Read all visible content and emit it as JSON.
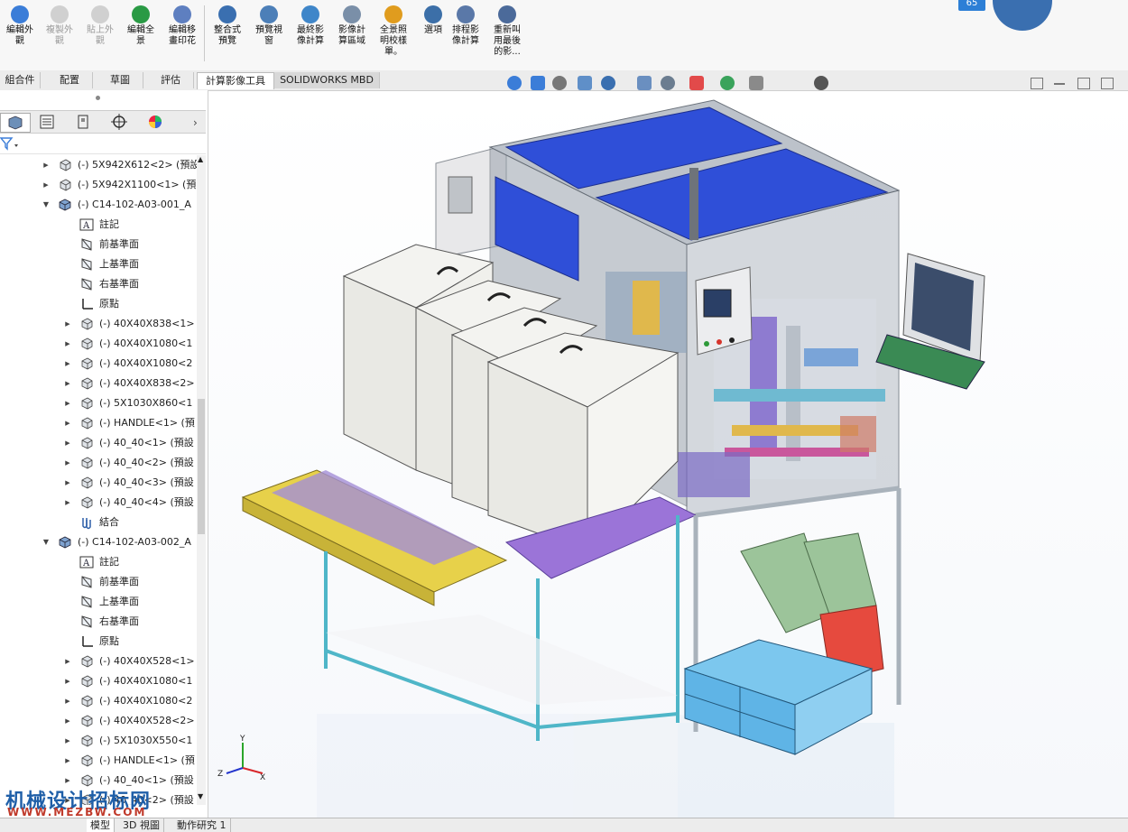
{
  "ribbon": {
    "buttons": [
      {
        "label": "編輯外\n觀",
        "icon": "edit-appearance-icon",
        "enabled": true
      },
      {
        "label": "複製外\n觀",
        "icon": "copy-appearance-icon",
        "enabled": false
      },
      {
        "label": "貼上外\n觀",
        "icon": "paste-appearance-icon",
        "enabled": false
      },
      {
        "label": "編輯全\n景",
        "icon": "edit-scene-icon",
        "enabled": true
      },
      {
        "label": "編輯移\n畫印花",
        "icon": "edit-decal-icon",
        "enabled": true
      },
      {
        "label": "整合式\n預覽",
        "icon": "integrated-preview-icon",
        "enabled": true
      },
      {
        "label": "預覽視\n窗",
        "icon": "preview-window-icon",
        "enabled": true
      },
      {
        "label": "最終影\n像計算",
        "icon": "final-render-icon",
        "enabled": true
      },
      {
        "label": "影像計\n算區域",
        "icon": "render-region-icon",
        "enabled": true
      },
      {
        "label": "全景照\n明校樣\n單。",
        "icon": "illumination-proof-icon",
        "enabled": true
      },
      {
        "label": "選項",
        "icon": "options-icon",
        "enabled": true
      },
      {
        "label": "排程影\n像計算",
        "icon": "schedule-render-icon",
        "enabled": true
      },
      {
        "label": "重新叫\n用最後\n的影...",
        "icon": "recall-last-render-icon",
        "enabled": true
      }
    ],
    "badge": "65"
  },
  "tabs": [
    {
      "label": "組合件",
      "active": false
    },
    {
      "label": "配置",
      "active": false
    },
    {
      "label": "草圖",
      "active": false
    },
    {
      "label": "評估",
      "active": false
    },
    {
      "label": "計算影像工具",
      "active": true
    },
    {
      "label": "SOLIDWORKS MBD",
      "active": false
    }
  ],
  "tree": [
    {
      "label": "(-) 5X942X612<2> (預設",
      "indent": 1,
      "arrow": "right",
      "icon": "part-icon"
    },
    {
      "label": "(-) 5X942X1100<1> (預",
      "indent": 1,
      "arrow": "right",
      "icon": "part-icon"
    },
    {
      "label": "(-) C14-102-A03-001_A",
      "indent": 1,
      "arrow": "down",
      "icon": "assembly-icon"
    },
    {
      "label": "註記",
      "indent": 2,
      "arrow": "",
      "icon": "annotation-icon"
    },
    {
      "label": "前基準面",
      "indent": 2,
      "arrow": "",
      "icon": "plane-icon"
    },
    {
      "label": "上基準面",
      "indent": 2,
      "arrow": "",
      "icon": "plane-icon"
    },
    {
      "label": "右基準面",
      "indent": 2,
      "arrow": "",
      "icon": "plane-icon"
    },
    {
      "label": "原點",
      "indent": 2,
      "arrow": "",
      "icon": "origin-icon"
    },
    {
      "label": "(-) 40X40X838<1>",
      "indent": 2,
      "arrow": "right",
      "icon": "part-icon"
    },
    {
      "label": "(-) 40X40X1080<1",
      "indent": 2,
      "arrow": "right",
      "icon": "part-icon"
    },
    {
      "label": "(-) 40X40X1080<2",
      "indent": 2,
      "arrow": "right",
      "icon": "part-icon"
    },
    {
      "label": "(-) 40X40X838<2>",
      "indent": 2,
      "arrow": "right",
      "icon": "part-icon"
    },
    {
      "label": "(-) 5X1030X860<1",
      "indent": 2,
      "arrow": "right",
      "icon": "part-icon"
    },
    {
      "label": "(-) HANDLE<1> (預",
      "indent": 2,
      "arrow": "right",
      "icon": "part-icon"
    },
    {
      "label": "(-) 40_40<1> (預設",
      "indent": 2,
      "arrow": "right",
      "icon": "part-icon"
    },
    {
      "label": "(-) 40_40<2> (預設",
      "indent": 2,
      "arrow": "right",
      "icon": "part-icon"
    },
    {
      "label": "(-) 40_40<3> (預設",
      "indent": 2,
      "arrow": "right",
      "icon": "part-icon"
    },
    {
      "label": "(-) 40_40<4> (預設",
      "indent": 2,
      "arrow": "right",
      "icon": "part-icon"
    },
    {
      "label": "結合",
      "indent": 2,
      "arrow": "",
      "icon": "mates-icon"
    },
    {
      "label": "(-) C14-102-A03-002_A",
      "indent": 1,
      "arrow": "down",
      "icon": "assembly-icon"
    },
    {
      "label": "註記",
      "indent": 2,
      "arrow": "",
      "icon": "annotation-icon"
    },
    {
      "label": "前基準面",
      "indent": 2,
      "arrow": "",
      "icon": "plane-icon"
    },
    {
      "label": "上基準面",
      "indent": 2,
      "arrow": "",
      "icon": "plane-icon"
    },
    {
      "label": "右基準面",
      "indent": 2,
      "arrow": "",
      "icon": "plane-icon"
    },
    {
      "label": "原點",
      "indent": 2,
      "arrow": "",
      "icon": "origin-icon"
    },
    {
      "label": "(-) 40X40X528<1>",
      "indent": 2,
      "arrow": "right",
      "icon": "part-icon"
    },
    {
      "label": "(-) 40X40X1080<1",
      "indent": 2,
      "arrow": "right",
      "icon": "part-icon"
    },
    {
      "label": "(-) 40X40X1080<2",
      "indent": 2,
      "arrow": "right",
      "icon": "part-icon"
    },
    {
      "label": "(-) 40X40X528<2>",
      "indent": 2,
      "arrow": "right",
      "icon": "part-icon"
    },
    {
      "label": "(-) 5X1030X550<1",
      "indent": 2,
      "arrow": "right",
      "icon": "part-icon"
    },
    {
      "label": "(-) HANDLE<1> (預",
      "indent": 2,
      "arrow": "right",
      "icon": "part-icon"
    },
    {
      "label": "(-) 40_40<1> (預設",
      "indent": 2,
      "arrow": "right",
      "icon": "part-icon"
    },
    {
      "label": "(-) 40_40<2> (預設",
      "indent": 2,
      "arrow": "right",
      "icon": "part-icon"
    }
  ],
  "bottom_tabs": [
    {
      "label": "模型",
      "active": true
    },
    {
      "label": "3D 視圖",
      "active": false
    },
    {
      "label": "動作研究 1",
      "active": false
    }
  ],
  "triad": {
    "x": "X",
    "y": "Y",
    "z": "Z"
  },
  "watermark": {
    "title": "机械设计招标网",
    "url": "WWW.MEZBW.COM"
  },
  "colors": {
    "accent_blue": "#2f4fd8",
    "frame": "#9aa3ad",
    "tray_blue": "#5fb4e6",
    "tray_red": "#e64a3e",
    "yellow": "#e7d14a",
    "purple": "#9b74d8",
    "green": "#9cc49a"
  }
}
